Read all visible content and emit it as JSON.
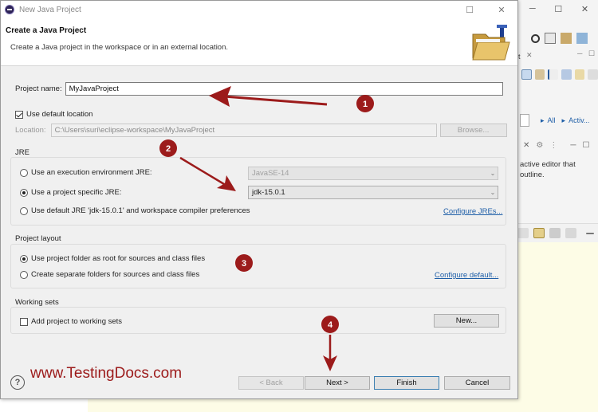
{
  "window": {
    "title": "New Java Project",
    "minimize_icon": "minimize-icon",
    "maximize_icon": "maximize-icon",
    "close_icon": "close-icon"
  },
  "banner": {
    "title": "Create a Java Project",
    "description": "Create a Java project in the workspace or in an external location.",
    "image_icon": "folder-wizard-icon"
  },
  "project_name": {
    "label": "Project name:",
    "value": "MyJavaProject"
  },
  "location": {
    "use_default_label": "Use default location",
    "use_default_checked": true,
    "label": "Location:",
    "value": "C:\\Users\\suri\\eclipse-workspace\\MyJavaProject",
    "browse_label": "Browse..."
  },
  "jre": {
    "group_title": "JRE",
    "options": [
      {
        "label": "Use an execution environment JRE:",
        "selected": false
      },
      {
        "label": "Use a project specific JRE:",
        "selected": true
      },
      {
        "label": "Use default JRE 'jdk-15.0.1' and workspace compiler preferences",
        "selected": false
      }
    ],
    "execution_env_value": "JavaSE-14",
    "project_jre_value": "jdk-15.0.1",
    "configure_link": "Configure JREs..."
  },
  "project_layout": {
    "group_title": "Project layout",
    "options": [
      {
        "label": "Use project folder as root for sources and class files",
        "selected": true
      },
      {
        "label": "Create separate folders for sources and class files",
        "selected": false
      }
    ],
    "configure_link": "Configure default..."
  },
  "working_sets": {
    "group_title": "Working sets",
    "add_label": "Add project to working sets",
    "add_checked": false,
    "new_button": "New..."
  },
  "buttons": {
    "help_icon": "help-icon",
    "back": "< Back",
    "next": "Next >",
    "finish": "Finish",
    "cancel": "Cancel"
  },
  "background_ide": {
    "filter_links": [
      "All",
      "Activ..."
    ],
    "outline_message": "active editor that outline."
  },
  "annotations": {
    "markers": [
      "1",
      "2",
      "3",
      "4"
    ],
    "watermark": "www.TestingDocs.com",
    "color": "#9c1b1b"
  }
}
